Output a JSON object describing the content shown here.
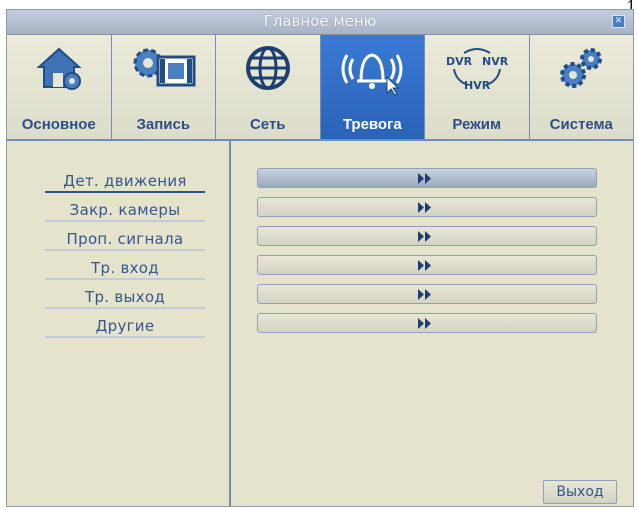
{
  "corner_mark": "1",
  "window": {
    "title": "Главное меню",
    "close_icon": "close-icon"
  },
  "tabs": [
    {
      "label": "Основное",
      "icon": "home-gear-icon"
    },
    {
      "label": "Запись",
      "icon": "record-gear-film-icon"
    },
    {
      "label": "Сеть",
      "icon": "globe-icon"
    },
    {
      "label": "Тревога",
      "icon": "alarm-bell-icon",
      "active": true
    },
    {
      "label": "Режим",
      "icon": "dvr-nvr-hvr-mode-icon"
    },
    {
      "label": "Система",
      "icon": "gears-icon"
    }
  ],
  "sidebar": {
    "items": [
      {
        "label": "Дет. движения",
        "active": true
      },
      {
        "label": "Закр. камеры"
      },
      {
        "label": "Проп. сигнала"
      },
      {
        "label": "Тр. вход"
      },
      {
        "label": "Тр. выход"
      },
      {
        "label": "Другие"
      }
    ]
  },
  "bar_icon": "double-arrow-right-icon",
  "mode_icon_text": {
    "dvr": "DVR",
    "nvr": "NVR",
    "hvr": "HVR"
  },
  "footer": {
    "exit_label": "Выход"
  },
  "colors": {
    "accent": "#2a63b8",
    "label_blue": "#2d4f86",
    "background": "#e5e3cc"
  }
}
